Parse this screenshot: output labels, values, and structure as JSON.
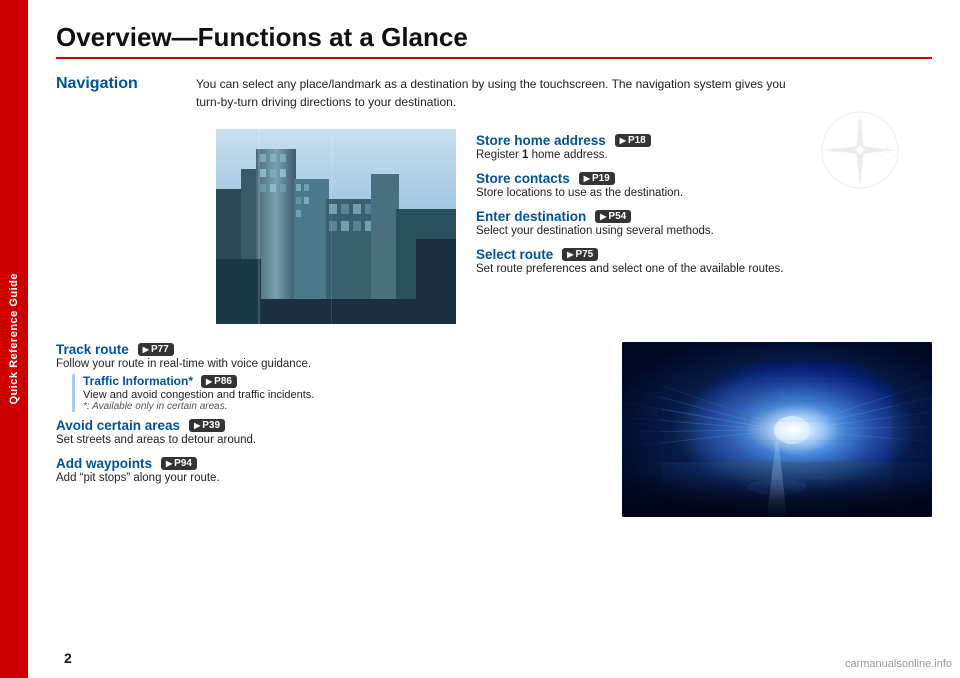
{
  "sidebar": {
    "label": "Quick Reference Guide"
  },
  "page": {
    "title": "Overview—Functions at a Glance",
    "number": "2"
  },
  "navigation": {
    "heading": "Navigation",
    "intro": "You can select any place/landmark as a destination by using the touchscreen. The navigation system gives you\nturn-by-turn driving directions to your destination."
  },
  "features_upper": [
    {
      "title": "Store home address",
      "ref": "P18",
      "desc": "Register 1 home address."
    },
    {
      "title": "Store contacts",
      "ref": "P19",
      "desc": "Store locations to use as the destination."
    },
    {
      "title": "Enter destination",
      "ref": "P54",
      "desc": "Select your destination using several methods."
    },
    {
      "title": "Select route",
      "ref": "P75",
      "desc": "Set route preferences and select one of the available routes."
    }
  ],
  "features_lower": [
    {
      "title": "Track route",
      "ref": "P77",
      "desc": "Follow your route in real-time with voice guidance.",
      "sub": {
        "title": "Traffic Information*",
        "ref": "P86",
        "desc": "View and avoid congestion and traffic incidents.",
        "note": "*: Available only in certain areas."
      }
    },
    {
      "title": "Avoid certain areas",
      "ref": "P39",
      "desc": "Set streets and areas to detour around."
    },
    {
      "title": "Add waypoints",
      "ref": "P94",
      "desc": "Add “pit stops” along your route."
    }
  ],
  "watermark": "carmanualsonline.info"
}
